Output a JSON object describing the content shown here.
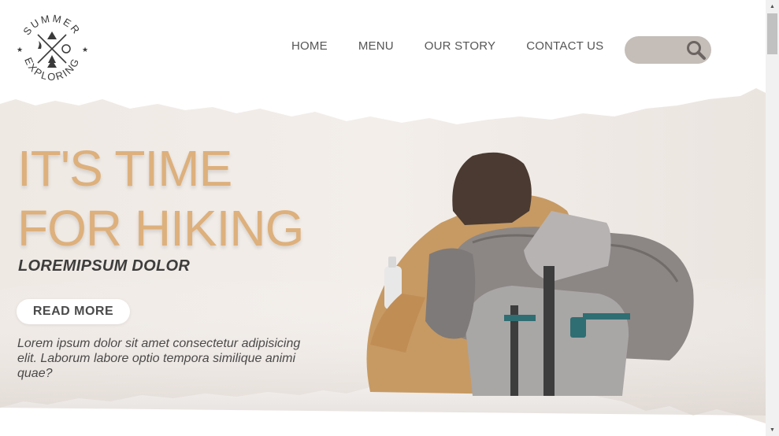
{
  "logo": {
    "top_text": "SUMMER",
    "bottom_text": "EXPLORING"
  },
  "nav": {
    "items": [
      "HOME",
      "MENU",
      "OUR STORY",
      "CONTACT US"
    ]
  },
  "search": {
    "placeholder": "",
    "icon": "search-icon"
  },
  "hero": {
    "title_line1": "IT'S TIME",
    "title_line2": "FOR HIKING",
    "subtitle": "LOREMIPSUM DOLOR",
    "button_label": "READ MORE",
    "description": "Lorem ipsum dolor sit amet consectetur adipisicing elit. Laborum labore optio tempora similique animi quae?"
  },
  "colors": {
    "title": "#ddb07c",
    "search_bg": "#c4bdb8",
    "text_dark": "#3d3d3d",
    "nav_text": "#555555"
  }
}
